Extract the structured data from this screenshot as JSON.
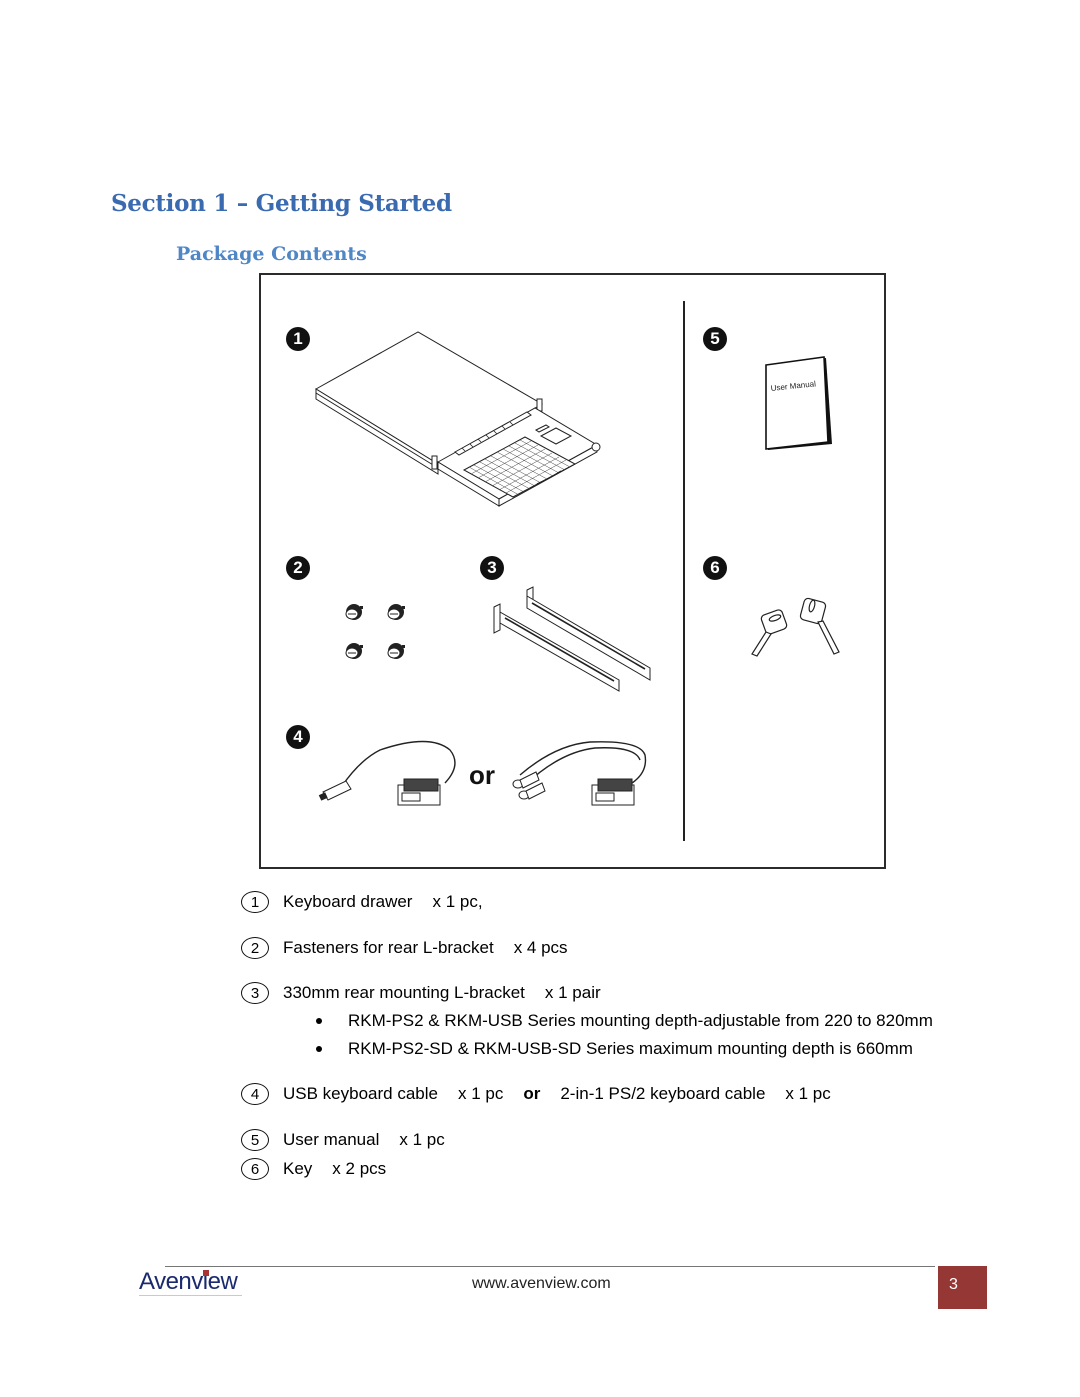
{
  "section_title": "Section 1 – Getting Started",
  "subsection_title": "Package Contents",
  "figure": {
    "item_numbers": [
      "1",
      "2",
      "3",
      "4",
      "5",
      "6"
    ],
    "manual_cover_text": "User Manual",
    "cable_separator": "or"
  },
  "items": [
    {
      "number": "1",
      "name": "Keyboard drawer",
      "qty": "x 1 pc,"
    },
    {
      "number": "2",
      "name": "Fasteners for rear L-bracket",
      "qty": "x 4 pcs"
    },
    {
      "number": "3",
      "name": "330mm rear mounting L-bracket",
      "qty": "x 1 pair",
      "notes": [
        "RKM-PS2 & RKM-USB Series mounting depth-adjustable from 220 to 820mm",
        "RKM-PS2-SD & RKM-USB-SD Series maximum mounting depth is 660mm"
      ]
    },
    {
      "number": "4",
      "name": "USB keyboard cable",
      "qty": "x 1 pc",
      "or": "or",
      "alt_name": "2-in-1 PS/2 keyboard cable",
      "alt_qty": "x 1 pc"
    },
    {
      "number": "5",
      "name": "User manual",
      "qty": "x 1 pc"
    },
    {
      "number": "6",
      "name": "Key",
      "qty": "x 2 pcs"
    }
  ],
  "footer": {
    "logo_text": "Avenview",
    "url": "www.avenview.com",
    "page_number": "3",
    "page_box_color": "#953735"
  },
  "colors": {
    "heading1": "#3a6ab0",
    "heading2": "#4f86c6"
  }
}
